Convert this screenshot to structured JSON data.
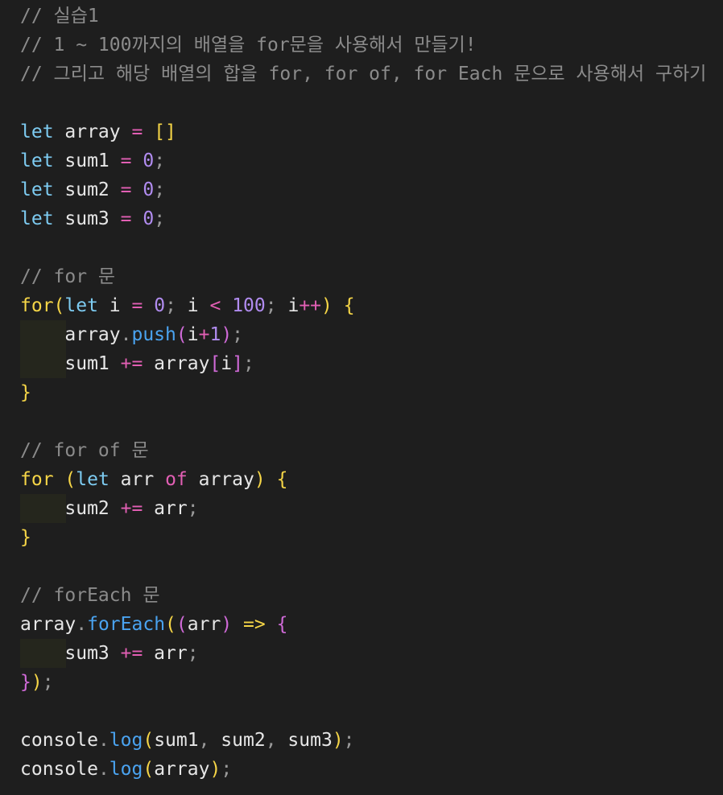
{
  "editor": {
    "language": "javascript",
    "colors": {
      "background": "#1e1e1e",
      "comment": "#8b8b8b",
      "keyword": "#7dcbf1",
      "identifier": "#e6e6e6",
      "operator": "#e25fb4",
      "number": "#b18cf0",
      "punctuation": "#9a9a9a",
      "bracket": "#f5d547",
      "bracket_nested": "#d06ad8",
      "function": "#4aa3f0",
      "indent_guide": "#25261d"
    },
    "lines": [
      {
        "tokens": [
          {
            "t": "// 실습1",
            "c": "comment"
          }
        ]
      },
      {
        "tokens": [
          {
            "t": "// 1 ~ 100까지의 배열을 for문을 사용해서 만들기!",
            "c": "comment"
          }
        ]
      },
      {
        "tokens": [
          {
            "t": "// 그리고 해당 배열의 합을 for, for of, for Each 문으로 사용해서 구하기",
            "c": "comment"
          }
        ]
      },
      {
        "tokens": []
      },
      {
        "tokens": [
          {
            "t": "let",
            "c": "keyword"
          },
          {
            "t": " array ",
            "c": "ident"
          },
          {
            "t": "=",
            "c": "op"
          },
          {
            "t": " ",
            "c": "ident"
          },
          {
            "t": "[]",
            "c": "brace"
          }
        ]
      },
      {
        "tokens": [
          {
            "t": "let",
            "c": "keyword"
          },
          {
            "t": " sum1 ",
            "c": "ident"
          },
          {
            "t": "=",
            "c": "op"
          },
          {
            "t": " ",
            "c": "ident"
          },
          {
            "t": "0",
            "c": "num"
          },
          {
            "t": ";",
            "c": "punct"
          }
        ]
      },
      {
        "tokens": [
          {
            "t": "let",
            "c": "keyword"
          },
          {
            "t": " sum2 ",
            "c": "ident"
          },
          {
            "t": "=",
            "c": "op"
          },
          {
            "t": " ",
            "c": "ident"
          },
          {
            "t": "0",
            "c": "num"
          },
          {
            "t": ";",
            "c": "punct"
          }
        ]
      },
      {
        "tokens": [
          {
            "t": "let",
            "c": "keyword"
          },
          {
            "t": " sum3 ",
            "c": "ident"
          },
          {
            "t": "=",
            "c": "op"
          },
          {
            "t": " ",
            "c": "ident"
          },
          {
            "t": "0",
            "c": "num"
          },
          {
            "t": ";",
            "c": "punct"
          }
        ]
      },
      {
        "tokens": []
      },
      {
        "tokens": [
          {
            "t": "// for 문",
            "c": "comment"
          }
        ]
      },
      {
        "tokens": [
          {
            "t": "for",
            "c": "brace"
          },
          {
            "t": "(",
            "c": "brace"
          },
          {
            "t": "let",
            "c": "keyword"
          },
          {
            "t": " i ",
            "c": "ident"
          },
          {
            "t": "=",
            "c": "op"
          },
          {
            "t": " ",
            "c": "ident"
          },
          {
            "t": "0",
            "c": "num"
          },
          {
            "t": ";",
            "c": "punct"
          },
          {
            "t": " i ",
            "c": "ident"
          },
          {
            "t": "<",
            "c": "op"
          },
          {
            "t": " ",
            "c": "ident"
          },
          {
            "t": "100",
            "c": "num"
          },
          {
            "t": ";",
            "c": "punct"
          },
          {
            "t": " i",
            "c": "ident"
          },
          {
            "t": "++",
            "c": "op"
          },
          {
            "t": ")",
            "c": "brace"
          },
          {
            "t": " ",
            "c": "ident"
          },
          {
            "t": "{",
            "c": "brace"
          }
        ]
      },
      {
        "guide": true,
        "tokens": [
          {
            "t": "    array",
            "c": "ident"
          },
          {
            "t": ".",
            "c": "punct"
          },
          {
            "t": "push",
            "c": "func"
          },
          {
            "t": "(",
            "c": "paren2"
          },
          {
            "t": "i",
            "c": "ident"
          },
          {
            "t": "+",
            "c": "op"
          },
          {
            "t": "1",
            "c": "num"
          },
          {
            "t": ")",
            "c": "paren2"
          },
          {
            "t": ";",
            "c": "punct"
          }
        ]
      },
      {
        "guide": true,
        "tokens": [
          {
            "t": "    sum1 ",
            "c": "ident"
          },
          {
            "t": "+=",
            "c": "op"
          },
          {
            "t": " array",
            "c": "ident"
          },
          {
            "t": "[",
            "c": "paren2"
          },
          {
            "t": "i",
            "c": "ident"
          },
          {
            "t": "]",
            "c": "paren2"
          },
          {
            "t": ";",
            "c": "punct"
          }
        ]
      },
      {
        "tokens": [
          {
            "t": "}",
            "c": "brace"
          }
        ]
      },
      {
        "tokens": []
      },
      {
        "tokens": [
          {
            "t": "// for of 문",
            "c": "comment"
          }
        ]
      },
      {
        "tokens": [
          {
            "t": "for",
            "c": "brace"
          },
          {
            "t": " ",
            "c": "ident"
          },
          {
            "t": "(",
            "c": "brace"
          },
          {
            "t": "let",
            "c": "keyword"
          },
          {
            "t": " arr ",
            "c": "ident"
          },
          {
            "t": "of",
            "c": "of"
          },
          {
            "t": " array",
            "c": "ident"
          },
          {
            "t": ")",
            "c": "brace"
          },
          {
            "t": " ",
            "c": "ident"
          },
          {
            "t": "{",
            "c": "brace"
          }
        ]
      },
      {
        "guide": true,
        "tokens": [
          {
            "t": "    sum2 ",
            "c": "ident"
          },
          {
            "t": "+=",
            "c": "op"
          },
          {
            "t": " arr",
            "c": "ident"
          },
          {
            "t": ";",
            "c": "punct"
          }
        ]
      },
      {
        "tokens": [
          {
            "t": "}",
            "c": "brace"
          }
        ]
      },
      {
        "tokens": []
      },
      {
        "tokens": [
          {
            "t": "// forEach 문",
            "c": "comment"
          }
        ]
      },
      {
        "tokens": [
          {
            "t": "array",
            "c": "ident"
          },
          {
            "t": ".",
            "c": "punct"
          },
          {
            "t": "forEach",
            "c": "func"
          },
          {
            "t": "(",
            "c": "brace"
          },
          {
            "t": "(",
            "c": "paren2"
          },
          {
            "t": "arr",
            "c": "ident"
          },
          {
            "t": ")",
            "c": "paren2"
          },
          {
            "t": " ",
            "c": "ident"
          },
          {
            "t": "=>",
            "c": "brace"
          },
          {
            "t": " ",
            "c": "ident"
          },
          {
            "t": "{",
            "c": "paren2"
          }
        ]
      },
      {
        "guide": true,
        "tokens": [
          {
            "t": "    sum3 ",
            "c": "ident"
          },
          {
            "t": "+=",
            "c": "op"
          },
          {
            "t": " arr",
            "c": "ident"
          },
          {
            "t": ";",
            "c": "punct"
          }
        ]
      },
      {
        "tokens": [
          {
            "t": "}",
            "c": "paren2"
          },
          {
            "t": ")",
            "c": "brace"
          },
          {
            "t": ";",
            "c": "punct"
          }
        ]
      },
      {
        "tokens": []
      },
      {
        "tokens": [
          {
            "t": "console",
            "c": "ident"
          },
          {
            "t": ".",
            "c": "punct"
          },
          {
            "t": "log",
            "c": "func"
          },
          {
            "t": "(",
            "c": "brace"
          },
          {
            "t": "sum1",
            "c": "ident"
          },
          {
            "t": ",",
            "c": "punct"
          },
          {
            "t": " sum2",
            "c": "ident"
          },
          {
            "t": ",",
            "c": "punct"
          },
          {
            "t": " sum3",
            "c": "ident"
          },
          {
            "t": ")",
            "c": "brace"
          },
          {
            "t": ";",
            "c": "punct"
          }
        ]
      },
      {
        "tokens": [
          {
            "t": "console",
            "c": "ident"
          },
          {
            "t": ".",
            "c": "punct"
          },
          {
            "t": "log",
            "c": "func"
          },
          {
            "t": "(",
            "c": "brace"
          },
          {
            "t": "array",
            "c": "ident"
          },
          {
            "t": ")",
            "c": "brace"
          },
          {
            "t": ";",
            "c": "punct"
          }
        ]
      }
    ]
  }
}
